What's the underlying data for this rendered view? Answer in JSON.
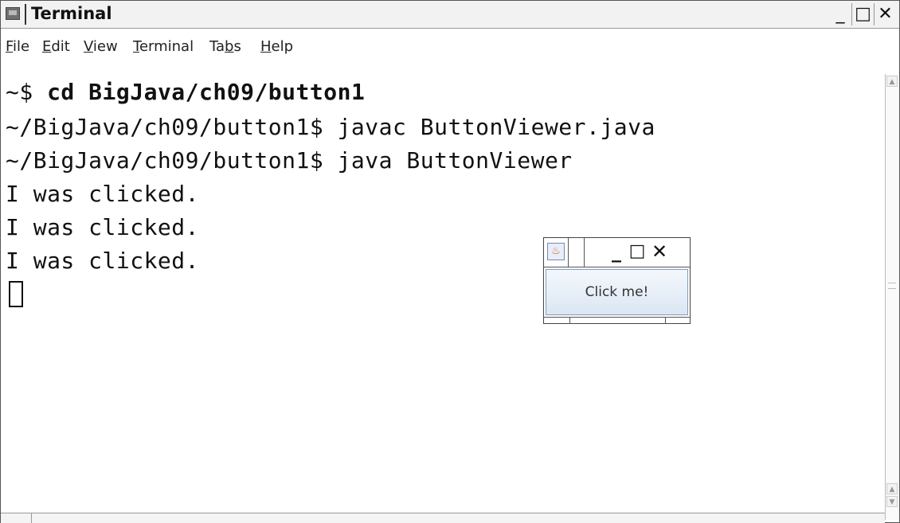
{
  "window": {
    "title": "Terminal",
    "minimize_glyph": "_",
    "maximize_glyph": "□",
    "close_glyph": "✕"
  },
  "menubar": {
    "items": [
      {
        "mnemonic": "F",
        "rest": "ile"
      },
      {
        "mnemonic": "E",
        "rest": "dit"
      },
      {
        "mnemonic": "V",
        "rest": "iew"
      },
      {
        "mnemonic": "T",
        "rest": "erminal"
      },
      {
        "pre": "Ta",
        "mnemonic": "b",
        "rest": "s"
      },
      {
        "mnemonic": "H",
        "rest": "elp"
      }
    ]
  },
  "terminal": {
    "lines": [
      {
        "prompt": "~$ ",
        "command": "cd BigJava/ch09/button1"
      },
      {
        "prompt": "~/BigJava/ch09/button1$ ",
        "command": "javac ButtonViewer.java"
      },
      {
        "prompt": "~/BigJava/ch09/button1$ ",
        "command": "java ButtonViewer"
      },
      {
        "output": "I was clicked."
      },
      {
        "output": "I was clicked."
      },
      {
        "output": "I was clicked."
      }
    ]
  },
  "java_window": {
    "icon": "java-cup-icon",
    "minimize_glyph": "_",
    "maximize_glyph": "□",
    "close_glyph": "✕",
    "button_label": "Click me!"
  },
  "colors": {
    "button_gradient_top": "#f4f8fd",
    "button_gradient_bottom": "#dbe6f3",
    "button_border": "#7f9db9",
    "java_icon_color": "#d66a1c"
  }
}
